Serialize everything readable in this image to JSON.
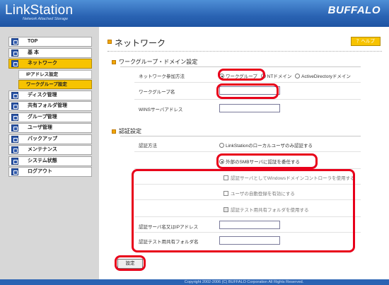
{
  "header": {
    "brand": "LinkStation",
    "subtitle": "Network Attached Storage",
    "logo": "BUFFALO"
  },
  "sidebar": {
    "items": [
      {
        "label": "TOP",
        "icon": "doc-icon"
      },
      {
        "label": "基 本",
        "icon": "doc-icon"
      },
      {
        "label": "ネットワーク",
        "icon": "network-icon",
        "active": true
      },
      {
        "label": "IPアドレス設定",
        "sub": true
      },
      {
        "label": "ワークグループ設定",
        "sub": true,
        "active": true
      },
      {
        "label": "ディスク管理",
        "icon": "disk-icon"
      },
      {
        "label": "共有フォルダ管理",
        "icon": "folder-icon"
      },
      {
        "label": "グループ管理",
        "icon": "group-icon"
      },
      {
        "label": "ユーザ管理",
        "icon": "user-icon"
      },
      {
        "label": "バックアップ",
        "icon": "backup-icon"
      },
      {
        "label": "メンテナンス",
        "icon": "maintenance-icon"
      },
      {
        "label": "システム状態",
        "icon": "status-icon"
      },
      {
        "label": "ログアウト",
        "icon": "logout-icon"
      }
    ]
  },
  "main": {
    "title": "ネットワーク",
    "help": "？ヘルプ",
    "workgroup": {
      "section": "ワークグループ・ドメイン設定",
      "join_label": "ネットワーク参加方法",
      "join_options": [
        "ワークグループ",
        "NTドメイン",
        "ActiveDirectoryドメイン"
      ],
      "name_label": "ワークグループ名",
      "name_value": "",
      "wins_label": "WINSサーバアドレス",
      "wins_value": ""
    },
    "auth": {
      "section": "認証設定",
      "method_label": "認証方法",
      "method_options": [
        "LinkStationのローカルユーザのみ認証する",
        "外部のSMBサーバに認証を委任する"
      ],
      "check1": "認証サーバとしてWindowsドメインコントローラを使用する",
      "check2": "ユーザの自動登録を有効にする",
      "check3": "認証テスト用共有フォルダを使用する",
      "server_label": "認証サーバ名又はIPアドレス",
      "server_value": "",
      "folder_label": "認証テスト用共有フォルダ名",
      "folder_value": ""
    },
    "set_button": "設定"
  },
  "footer": "Copyright 2002-2006 (C) BUFFALO Corporation All Rights Reserved.",
  "colors": {
    "header": "#2a63b3",
    "accent": "#f7c300",
    "highlight": "#e8001a"
  }
}
